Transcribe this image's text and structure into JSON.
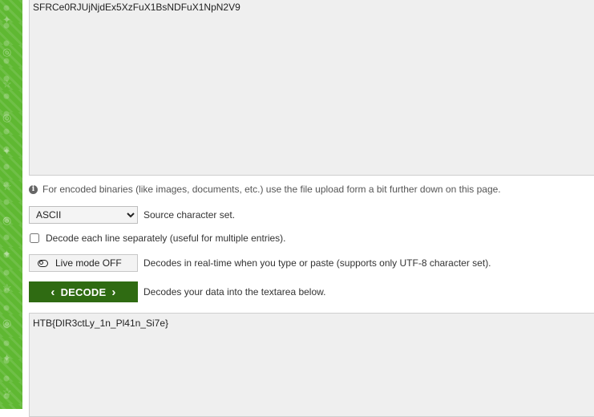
{
  "input": {
    "value": "SFRCe0RJUjNjdEx5XzFuX1BsNDFuX1NpN2V9"
  },
  "info": {
    "text": "For encoded binaries (like images, documents, etc.) use the file upload form a bit further down on this page."
  },
  "charset": {
    "selected": "ASCII",
    "description": "Source character set."
  },
  "each_line": {
    "label": "Decode each line separately (useful for multiple entries)."
  },
  "live_mode": {
    "label": "Live mode OFF",
    "description": "Decodes in real-time when you type or paste (supports only UTF-8 character set)."
  },
  "decode": {
    "label": "DECODE",
    "description": "Decodes your data into the textarea below."
  },
  "output": {
    "value": "HTB{DIR3ctLy_1n_Pl41n_Si7e}"
  },
  "theme": {
    "strip_color": "#5fb832",
    "decode_button_color": "#2f6b12"
  }
}
